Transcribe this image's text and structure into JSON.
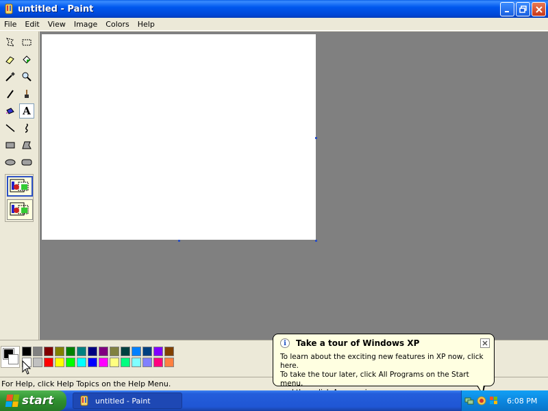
{
  "window": {
    "title": "untitled - Paint",
    "buttons": [
      "minimize",
      "maximize",
      "close"
    ]
  },
  "menu": [
    "File",
    "Edit",
    "View",
    "Image",
    "Colors",
    "Help"
  ],
  "tools": [
    {
      "name": "free-select",
      "icon": "free-select-icon"
    },
    {
      "name": "rect-select",
      "icon": "rect-select-icon"
    },
    {
      "name": "eraser",
      "icon": "eraser-icon"
    },
    {
      "name": "fill",
      "icon": "fill-bucket-icon"
    },
    {
      "name": "pick-color",
      "icon": "eyedropper-icon"
    },
    {
      "name": "magnifier",
      "icon": "magnifier-icon"
    },
    {
      "name": "pencil",
      "icon": "pencil-icon"
    },
    {
      "name": "brush",
      "icon": "brush-icon"
    },
    {
      "name": "airbrush",
      "icon": "airbrush-icon"
    },
    {
      "name": "text",
      "icon": "text-icon",
      "active": true
    },
    {
      "name": "line",
      "icon": "line-icon"
    },
    {
      "name": "curve",
      "icon": "curve-icon"
    },
    {
      "name": "rectangle",
      "icon": "rectangle-icon"
    },
    {
      "name": "polygon",
      "icon": "polygon-icon"
    },
    {
      "name": "ellipse",
      "icon": "ellipse-icon"
    },
    {
      "name": "rounded-rectangle",
      "icon": "rounded-rectangle-icon"
    }
  ],
  "palette": {
    "foreground": "#000000",
    "background": "#ffffff",
    "row1": [
      "#000000",
      "#808080",
      "#800000",
      "#808000",
      "#008000",
      "#008080",
      "#000080",
      "#800080",
      "#808040",
      "#004040",
      "#0080ff",
      "#004080",
      "#8000ff",
      "#804000"
    ],
    "row2": [
      "#ffffff",
      "#c0c0c0",
      "#ff0000",
      "#ffff00",
      "#00ff00",
      "#00ffff",
      "#0000ff",
      "#ff00ff",
      "#ffff80",
      "#00ff80",
      "#80ffff",
      "#8080ff",
      "#ff0080",
      "#ff8040"
    ]
  },
  "status": "For Help, click Help Topics on the Help Menu.",
  "balloon": {
    "title": "Take a tour of Windows XP",
    "line1": "To learn about the exciting new features in XP now, click here.",
    "line2": "To take the tour later, click All Programs on the Start menu,",
    "line3": "and then click Accessories."
  },
  "taskbar": {
    "start_label": "start",
    "task_label": "untitled - Paint",
    "clock": "6:08 PM"
  }
}
